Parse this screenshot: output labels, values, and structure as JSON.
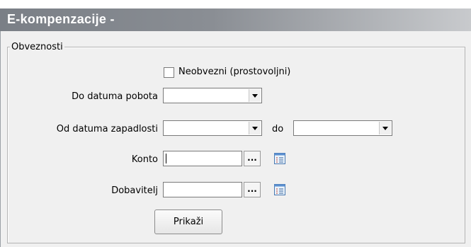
{
  "window": {
    "title": "E-kompenzacije -"
  },
  "group": {
    "title": "Obveznosti"
  },
  "form": {
    "optional_checkbox": {
      "label": "Neobvezni (prostovoljni)",
      "checked": false
    },
    "do_datuma_pobota": {
      "label": "Do datuma pobota",
      "value": ""
    },
    "od_datuma_zapadlosti": {
      "label": "Od datuma zapadlosti",
      "value": "",
      "to_label": "do",
      "to_value": ""
    },
    "konto": {
      "label": "Konto",
      "value": "",
      "lookup_label": "..."
    },
    "dobavitelj": {
      "label": "Dobavitelj",
      "value": "",
      "lookup_label": "..."
    },
    "show_button": {
      "label": "Prikaži"
    }
  },
  "icons": {
    "combo_arrow": "chevron-down-icon",
    "list_icon": "list-picker-icon"
  },
  "colors": {
    "titlebar_start": "#7a7f86",
    "titlebar_end": "#c8cacd",
    "background": "#f0f0f0"
  }
}
